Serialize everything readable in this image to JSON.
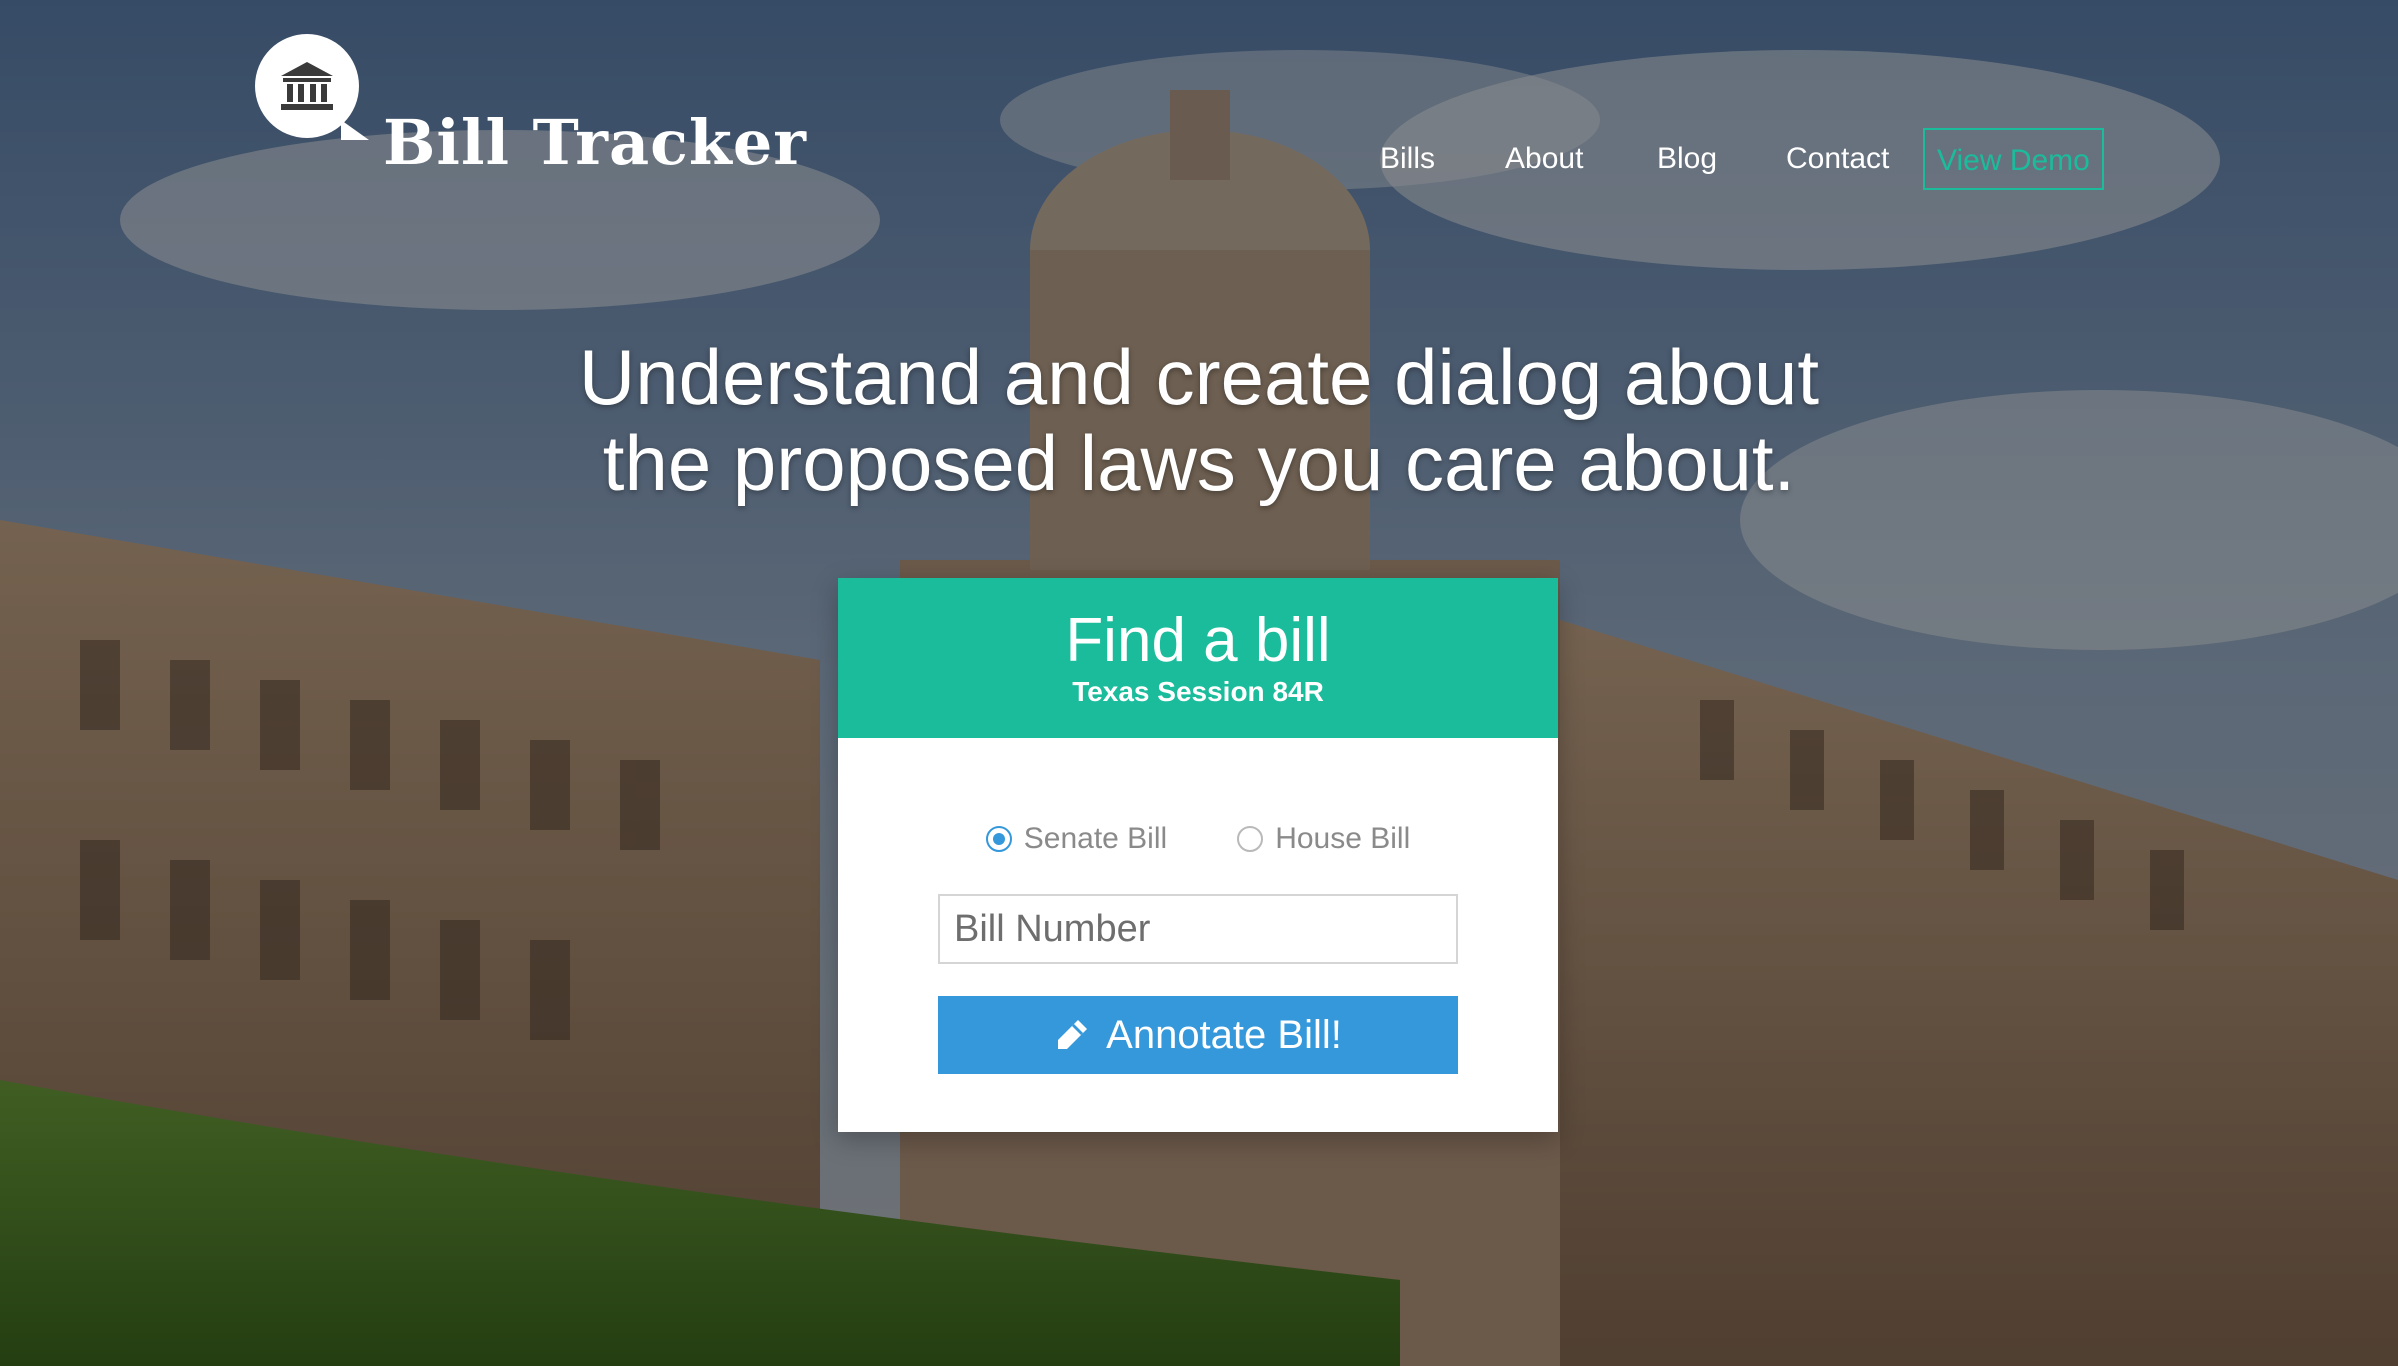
{
  "header": {
    "brand": "Bill Tracker",
    "logo_icon": "capitol-building-icon"
  },
  "nav": {
    "items": [
      "Bills",
      "About",
      "Blog",
      "Contact"
    ],
    "demo_label": "View Demo"
  },
  "hero": {
    "headline_line1": "Understand and create dialog about",
    "headline_line2": "the proposed laws you care about."
  },
  "card": {
    "title": "Find a bill",
    "subtitle": "Texas Session 84R",
    "radios": [
      {
        "label": "Senate Bill",
        "checked": true
      },
      {
        "label": "House Bill",
        "checked": false
      }
    ],
    "input_placeholder": "Bill Number",
    "input_value": "",
    "button_label": "Annotate Bill!",
    "button_icon": "pencil-icon"
  },
  "colors": {
    "accent": "#1abc9c",
    "button": "#3498db",
    "text_light": "#ffffff"
  }
}
